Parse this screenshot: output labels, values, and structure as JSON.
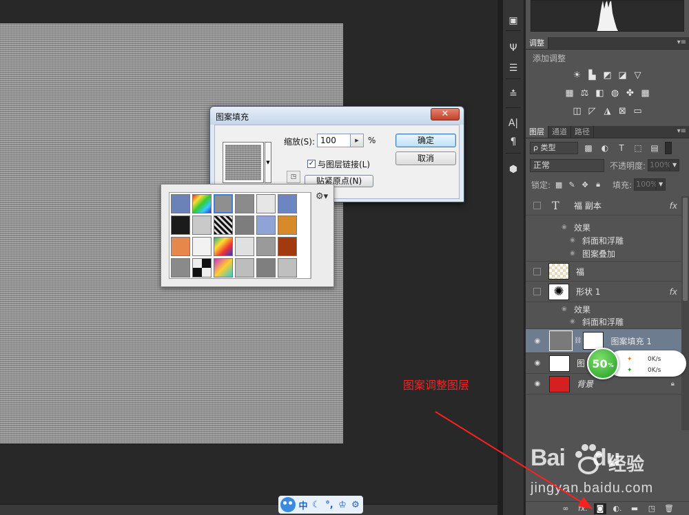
{
  "dialog": {
    "title": "图案填充",
    "close_label": "✕",
    "scale_label": "缩放(S):",
    "scale_value": "100",
    "scale_unit": "%",
    "link_checkbox_label": "与图层链接(L)",
    "link_checked": true,
    "snap_origin_label": "贴紧原点(N)",
    "ok_label": "确定",
    "cancel_label": "取消"
  },
  "pattern_picker": {
    "swatches": [
      "#6a82b8",
      "linear-gradient(135deg,#d33,#fd3,#3c3,#3cf,#33d)",
      "#8f8f8f",
      "#8b8b8b",
      "#e6e6e6",
      "#6d86c2",
      "#1b1b1b",
      "#c9c9c9",
      "repeating-linear-gradient(45deg,#111 0 3px,#ddd 3px 6px)",
      "#7d7d7d",
      "#8fa3d6",
      "#d68a2a",
      "#e8874a",
      "#f2f2f2",
      "linear-gradient(135deg,#3a8,#fd3,#e33,#33c)",
      "#e0e0e0",
      "#9a9a9a",
      "#a33a0f",
      "#8a8a8a",
      "repeating-conic-gradient(#111 0 25%,#eee 0 50%)",
      "linear-gradient(135deg,#c3c,#fc3,#3cc)",
      "#bdbdbd",
      "#7f7f7f",
      "#bfbfbf"
    ],
    "selected_index": 2
  },
  "adjustments_panel": {
    "tabs": [
      {
        "label": "调整"
      }
    ],
    "title": "添加调整"
  },
  "layers_panel": {
    "tabs": [
      {
        "label": "图层"
      },
      {
        "label": "通道"
      },
      {
        "label": "路径"
      }
    ],
    "filter_kind": "ρ 类型",
    "blend_mode": "正常",
    "opacity_label": "不透明度:",
    "opacity_value": "100%",
    "lock_label": "锁定:",
    "fill_label": "填充:",
    "fill_value": "100%",
    "layers": [
      {
        "name": "福 副本",
        "fx": "fx",
        "effects_label": "效果",
        "effects": [
          "斜面和浮雕",
          "图案叠加"
        ]
      },
      {
        "name": "福"
      },
      {
        "name": "形状 1",
        "fx": "fx",
        "effects_label": "效果",
        "effects": [
          "斜面和浮雕"
        ]
      },
      {
        "name": "图案填充 1"
      },
      {
        "name": "图"
      },
      {
        "name": "背景"
      }
    ]
  },
  "annotation": {
    "text": "图案调整图层",
    "color": "#ff2020"
  },
  "network_widget": {
    "percent": "50",
    "percent_sign": "%",
    "upload": "0K/s",
    "download": "0K/s"
  },
  "watermark": {
    "logo": "Bai",
    "logo_suffix": "du",
    "site": "经验",
    "url": "jingyan.baidu.com"
  },
  "ime_bar": {
    "mode": "中"
  }
}
